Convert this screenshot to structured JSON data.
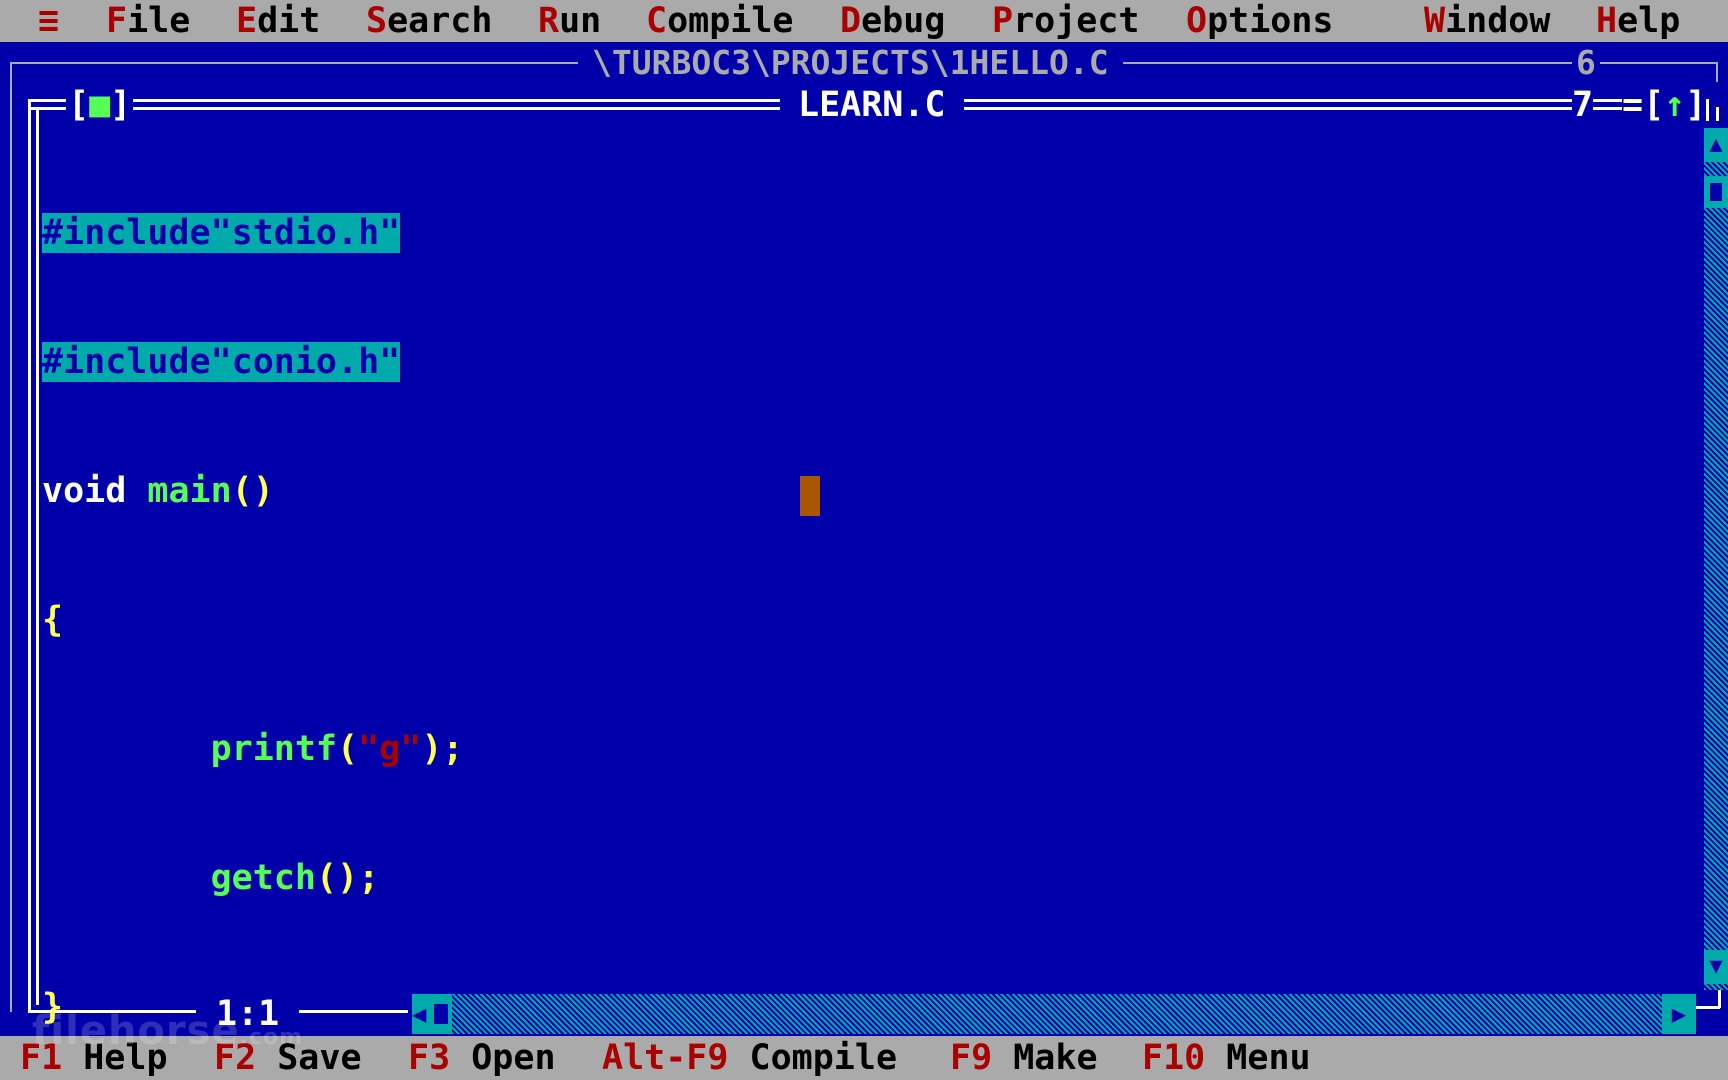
{
  "menu": {
    "system": "≡",
    "items": [
      {
        "hot": "F",
        "rest": "ile"
      },
      {
        "hot": "E",
        "rest": "dit"
      },
      {
        "hot": "S",
        "rest": "earch"
      },
      {
        "hot": "R",
        "rest": "un"
      },
      {
        "hot": "C",
        "rest": "ompile"
      },
      {
        "hot": "D",
        "rest": "ebug"
      },
      {
        "hot": "P",
        "rest": "roject"
      },
      {
        "hot": "O",
        "rest": "ptions"
      },
      {
        "hot": "W",
        "rest": "indow"
      },
      {
        "hot": "H",
        "rest": "elp"
      }
    ]
  },
  "back_window": {
    "title": "\\TURBOC3\\PROJECTS\\1HELLO.C",
    "number": "6"
  },
  "window": {
    "close_left": "[",
    "close_mark": "■",
    "close_right": "]",
    "title": "LEARN.C",
    "number": "7",
    "zoom_left": "=[",
    "zoom_mark": "↑",
    "zoom_right": "]"
  },
  "editor": {
    "lines": [
      {
        "a": "#include\"stdio.h\""
      },
      {
        "a": "#include\"conio.h\""
      },
      {
        "kw": "void",
        "sp": " ",
        "fn": "main",
        "pn": "()"
      },
      {
        "pn": "{"
      },
      {
        "indent": "        ",
        "fn": "printf",
        "pn1": "(",
        "q1": "\"",
        "st": "g",
        "q2": "\"",
        "pn2": ");"
      },
      {
        "indent": "        ",
        "fn": "getch",
        "pn": "();"
      },
      {
        "pn": "}"
      }
    ]
  },
  "status": {
    "cursor_pos": "1:1",
    "keys": [
      {
        "key": "F1",
        "label": "Help"
      },
      {
        "key": "F2",
        "label": "Save"
      },
      {
        "key": "F3",
        "label": "Open"
      },
      {
        "key": "Alt-F9",
        "label": "Compile"
      },
      {
        "key": "F9",
        "label": "Make"
      },
      {
        "key": "F10",
        "label": "Menu"
      }
    ]
  },
  "scroll": {
    "up": "▲",
    "down": "▼",
    "left": "◀",
    "right": "▶"
  },
  "watermark": {
    "text": "filehorse",
    "suffix": ".com"
  },
  "colors": {
    "background": "#0000AA",
    "menu": "#AAAAAA",
    "hotkey": "#AA0000",
    "selection": "#00AAAA",
    "function": "#55FF55",
    "punct": "#FFFF55",
    "cursor": "#AA5500"
  }
}
